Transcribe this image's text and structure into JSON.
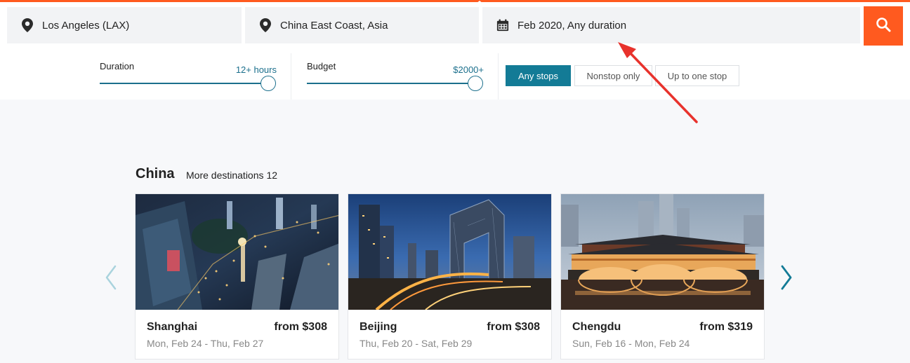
{
  "search": {
    "origin": "Los Angeles (LAX)",
    "destination": "China East Coast, Asia",
    "dates": "Feb 2020, Any duration"
  },
  "filters": {
    "duration": {
      "label": "Duration",
      "value": "12+ hours",
      "level": 1.0
    },
    "budget": {
      "label": "Budget",
      "value": "$2000+",
      "level": 1.0
    },
    "stops": [
      {
        "label": "Any stops",
        "active": true
      },
      {
        "label": "Nonstop only",
        "active": false
      },
      {
        "label": "Up to one stop",
        "active": false
      }
    ]
  },
  "section": {
    "title": "China",
    "more_label": "More destinations",
    "more_count": "12"
  },
  "cards": [
    {
      "city": "Shanghai",
      "price": "from $308",
      "dates": "Mon, Feb 24 - Thu, Feb 27"
    },
    {
      "city": "Beijing",
      "price": "from $308",
      "dates": "Thu, Feb 20 - Sat, Feb 29"
    },
    {
      "city": "Chengdu",
      "price": "from $319",
      "dates": "Sun, Feb 16 - Mon, Feb 24"
    }
  ],
  "icons": [
    "location-pin-icon",
    "calendar-icon",
    "search-icon",
    "chevron-left-icon",
    "chevron-right-icon"
  ],
  "colors": {
    "accent": "#ff5a1f",
    "teal": "#137b96",
    "annotation_arrow": "#e8322c"
  }
}
